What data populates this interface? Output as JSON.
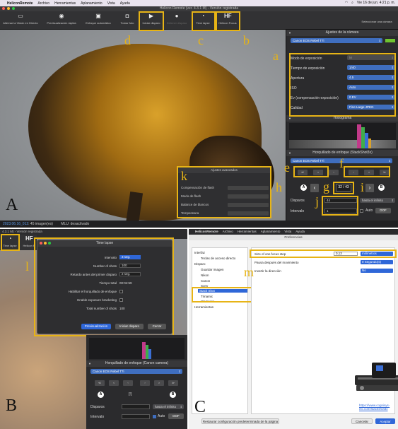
{
  "panel_a": {
    "letter": "A",
    "menubar": {
      "app": "HeliconRemote",
      "items": [
        "Archivo",
        "Herramientas",
        "Aplanamiento",
        "Vista",
        "Ayuda"
      ],
      "clock": "Vie 16 de jun.  4:21 p. m."
    },
    "window_title": "Helicon Remote (ver. 4.3.1 M) - Versión registrada",
    "toolbar": {
      "live_view": "Alternar la Visión en Directo",
      "quick_preview": "Previsualización rápida",
      "autofocus": "Enfoque automático",
      "take_photo": "Tomar foto",
      "start_shooting": "Iniciar disparo",
      "stop_shooting": "Detener disparo",
      "time_lapse": "Time lapse",
      "helicon_focus": "Helicon Focus",
      "hf_logo": "HF",
      "select_camera": "Seleccionar una cámara"
    },
    "camera_settings": {
      "header": "Ajustes de la cámara",
      "camera": "Canon EOS Rebel T7i",
      "rows": [
        {
          "label": "Modo de exposición",
          "value": "M"
        },
        {
          "label": "Tiempo de exposición",
          "value": "1/40"
        },
        {
          "label": "Apertura",
          "value": "4.5"
        },
        {
          "label": "ISO",
          "value": "Auto"
        },
        {
          "label": "Ev (compensación exposición)",
          "value": "0 EV"
        },
        {
          "label": "Calidad",
          "value": "Fine Large JPEG"
        }
      ]
    },
    "histogram_header": "Histograma",
    "bracketing": {
      "header": "Horquillado de enfoque (StackShot3x)",
      "camera": "Canon EOS Rebel T7i",
      "counter": "32 / 43",
      "marker_a": "A",
      "marker_b": "B",
      "shots_label": "Disparos",
      "shots_value": "44",
      "shots_mode": "hasta el infinito",
      "interval_label": "Intervalo",
      "interval_value": "1",
      "auto_label": "Auto",
      "dof_label": "DOF"
    },
    "advanced": {
      "header": "Ajustes avanzados",
      "rows": [
        "Compensación de flash",
        "Modo de flash",
        "Balance de blancos",
        "Temperatura"
      ]
    },
    "status": {
      "path": "2023.06.16_012",
      "images": ": 45 imagen(es)",
      "mlu": "MLU: desactivado"
    },
    "annotations": [
      "a",
      "b",
      "c",
      "d",
      "e",
      "f",
      "g",
      "h",
      "i",
      "j",
      "k"
    ]
  },
  "panel_b": {
    "letter": "B",
    "window_title": "4.3.1 M) - Versión registrada",
    "time_lapse_tool": "Time lapse",
    "hf_partial": "HF",
    "helicon_partial": "Helicon F",
    "dialog": {
      "title": "Time lapse",
      "rows": [
        {
          "label": "Intervalo",
          "value": "3 seg."
        },
        {
          "label": "Number of shots",
          "value": "100"
        },
        {
          "label": "Retardo antes del primer disparo",
          "value": "2 seg."
        },
        {
          "label": "Tiempo total",
          "value": "00:04:59"
        },
        {
          "label": "Habilitar el horquillado de enfoque",
          "value": ""
        },
        {
          "label": "Enable exposure bracketing",
          "value": ""
        },
        {
          "label": "Total number of shots",
          "value": "100"
        }
      ],
      "preview_btn": "Previsualización",
      "start_btn": "Iniciar disparo",
      "close_btn": "Cerrar"
    },
    "bracketing": {
      "header": "Horquillado de enfoque (Canon camera)",
      "camera": "Canon EOS Rebel T7i",
      "counter": "[!]",
      "marker_a": "A",
      "marker_b": "B",
      "shots_label": "Disparos",
      "shots_mode": "hasta el infinito",
      "interval_label": "Intervalo",
      "auto_label": "Auto",
      "dof_label": "DOF"
    },
    "annotation": "l"
  },
  "panel_c": {
    "letter": "C",
    "menubar": {
      "app": "HeliconRemote",
      "items": [
        "Archivo",
        "Herramientas",
        "Aplanamiento",
        "Vista",
        "Ayuda"
      ]
    },
    "window_title": "Preferencias",
    "tree": [
      {
        "label": "Interfaz",
        "level": 0
      },
      {
        "label": "Teclas de acceso directo",
        "level": 1
      },
      {
        "label": "Disparo",
        "level": 0
      },
      {
        "label": "Guardar imagen",
        "level": 1
      },
      {
        "label": "Nikon",
        "level": 1
      },
      {
        "label": "Canon",
        "level": 1
      },
      {
        "label": "Sony",
        "level": 1
      },
      {
        "label": "Stack Shot",
        "level": 1
      },
      {
        "label": "Trinamic",
        "level": 1
      },
      {
        "label": "Wemacro",
        "level": 1
      },
      {
        "label": "Herramientas",
        "level": 0
      }
    ],
    "pref": {
      "step_label": "Size of one focus step",
      "step_value": "0,13",
      "step_unit": "milímetros",
      "pause_label": "Pausa después del movimiento",
      "pause_value": "0 Segundo(s)",
      "invert_label": "Invertir la dirección",
      "invert_value": "No",
      "link": "https://www.cognisys-inc.com/stackshot3x"
    },
    "reset_btn": "Restaurar configuración predeterminada de la página",
    "cancel_btn": "Cancelar",
    "accept_btn": "Aceptar",
    "annotation": "m"
  },
  "colors": {
    "annotation": "#e7b416",
    "accent_blue": "#2f67d8",
    "dark_panel": "#2b2b2d"
  }
}
